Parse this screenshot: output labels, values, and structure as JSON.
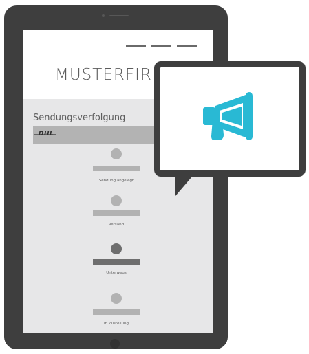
{
  "header": {
    "company_name": "MUSTERFIRMA"
  },
  "tracking": {
    "title": "Sendungsverfolgung",
    "carrier_logo": "DHL"
  },
  "steps": [
    {
      "label": "Sendung angelegt",
      "active": false
    },
    {
      "label": "Versand",
      "active": false
    },
    {
      "label": "Unterwegs",
      "active": true
    },
    {
      "label": "In Zustellung",
      "active": false
    }
  ],
  "icons": {
    "announcement": "megaphone-icon"
  },
  "colors": {
    "device": "#3e3e3e",
    "screen": "#e7e7e8",
    "active_step": "#6e6e6e",
    "inactive_step": "#b2b2b2",
    "accent": "#29b9d4"
  }
}
